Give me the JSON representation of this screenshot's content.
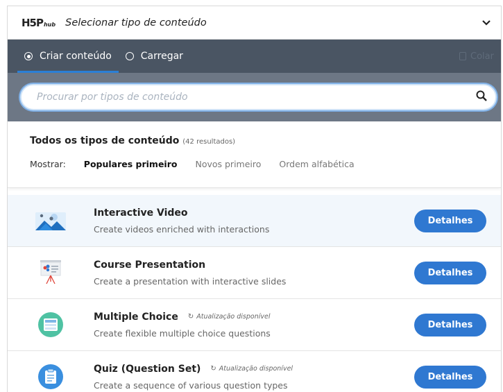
{
  "header": {
    "logo_main": "H5P",
    "logo_hub": "hub",
    "title": "Selecionar tipo de conteúdo"
  },
  "tabs": {
    "items": [
      {
        "label": "Criar conteúdo",
        "selected": true
      },
      {
        "label": "Carregar",
        "selected": false
      }
    ],
    "paste_label": "Colar"
  },
  "search": {
    "placeholder": "Procurar por tipos de conteúdo"
  },
  "list": {
    "title": "Todos os tipos de conteúdo",
    "count": "(42 resultados)",
    "sort_label": "Mostrar:",
    "sort_options": [
      "Populares primeiro",
      "Novos primeiro",
      "Ordem alfabética"
    ],
    "active_sort": 0
  },
  "colors": {
    "accent": "#2f78d1",
    "tabs_bg": "#4a5563",
    "search_bg": "#6d7785"
  },
  "content_types": [
    {
      "title": "Interactive Video",
      "description": "Create videos enriched with interactions",
      "update": "",
      "button": "Detalhes",
      "icon": "interactive-video-icon"
    },
    {
      "title": "Course Presentation",
      "description": "Create a presentation with interactive slides",
      "update": "",
      "button": "Detalhes",
      "icon": "course-presentation-icon"
    },
    {
      "title": "Multiple Choice",
      "description": "Create flexible multiple choice questions",
      "update": "Atualização disponível",
      "button": "Detalhes",
      "icon": "multiple-choice-icon"
    },
    {
      "title": "Quiz (Question Set)",
      "description": "Create a sequence of various question types",
      "update": "Atualização disponível",
      "button": "Detalhes",
      "icon": "quiz-icon"
    }
  ]
}
